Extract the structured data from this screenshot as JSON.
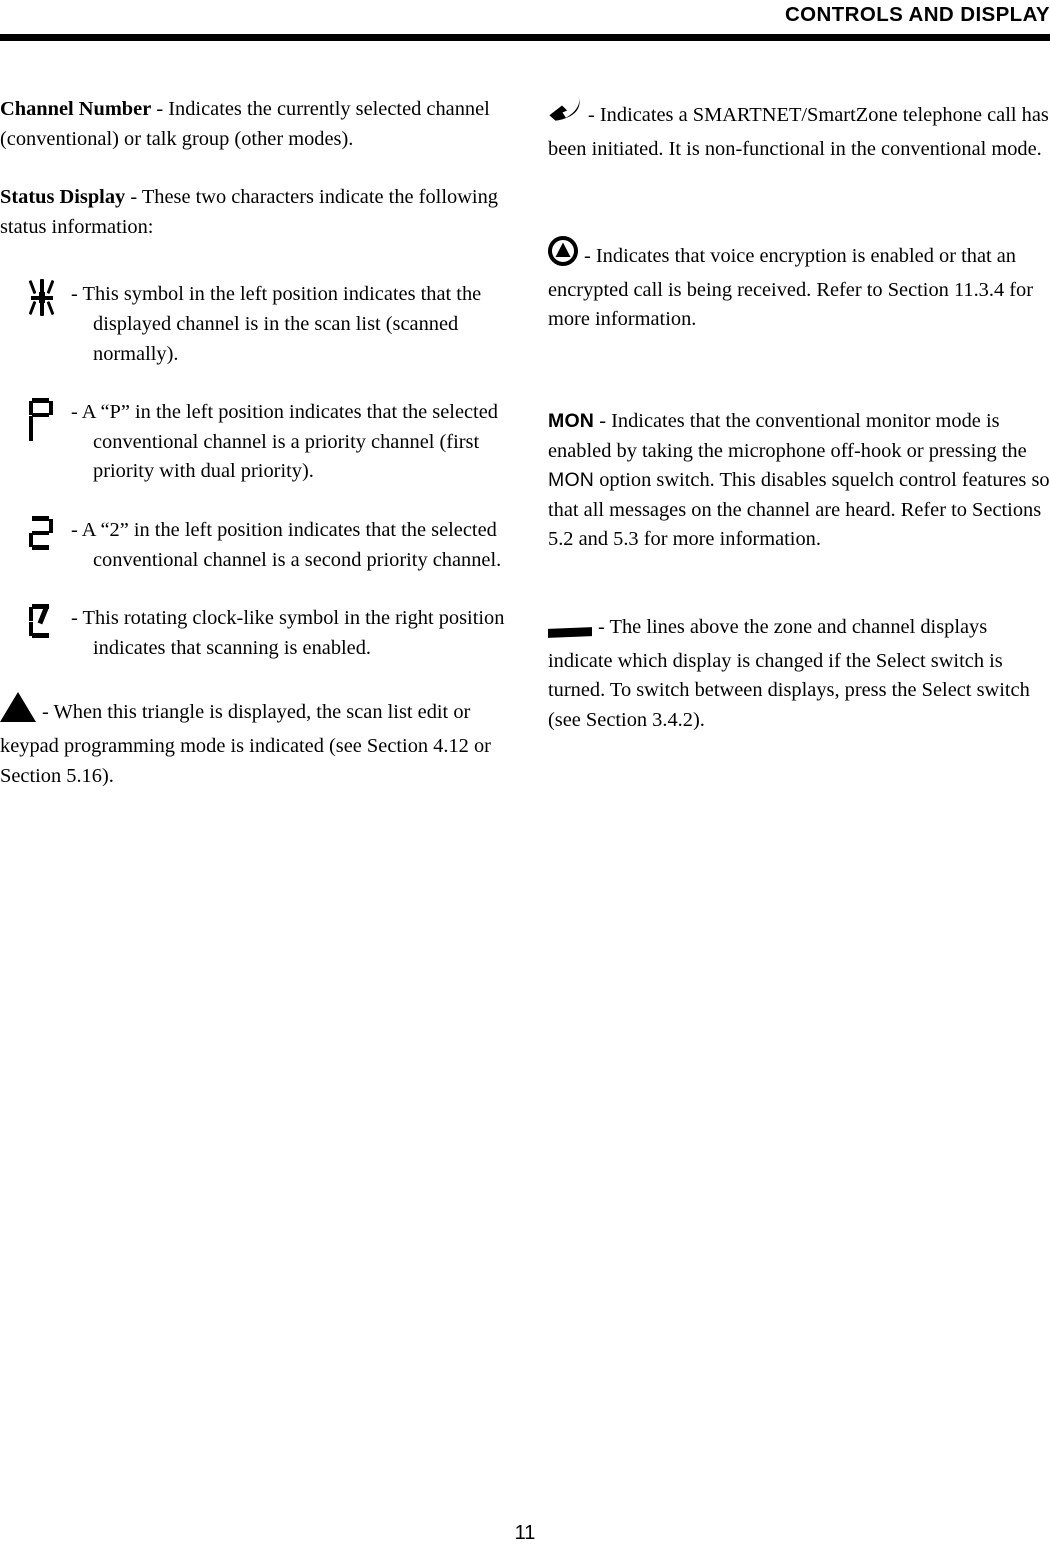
{
  "header": {
    "title": "CONTROLS AND DISPLAY"
  },
  "footer": {
    "page_number": "11"
  },
  "left_column": {
    "channel_number": {
      "lead": "Channel Number",
      "dash": " - ",
      "body": "Indicates the currently selected channel (conventional) or talk group (other modes)."
    },
    "status_display": {
      "lead": "Status Display",
      "dash": " - ",
      "body": "These two characters indicate the following status information:"
    },
    "items": [
      {
        "symbol": "scan-list-starburst-symbol",
        "text": "- This symbol in the left position indicates that the displayed channel is in the scan list (scanned normally)."
      },
      {
        "symbol": "seven-segment-p-symbol",
        "text": "- A “P” in the left position indicates that the selected conventional channel is a priority channel (first priority with dual priority)."
      },
      {
        "symbol": "seven-segment-two-symbol",
        "text": "- A “2” in the left position indicates that the selected conventional channel is a second priority channel."
      },
      {
        "symbol": "rotating-clock-symbol",
        "text": "- This rotating clock-like symbol in the right position indicates that scanning is enabled."
      }
    ],
    "triangle_item": {
      "symbol": "solid-triangle-symbol",
      "text": "- When this triangle is displayed, the scan list edit or keypad programming mode is indicated (see Section 4.12 or Section 5.16)."
    }
  },
  "right_column": {
    "telephone_item": {
      "symbol": "telephone-handset-icon",
      "text": "- Indicates a SMARTNET/SmartZone telephone call has been initiated. It is non-functional in the conventional mode."
    },
    "encryption_item": {
      "symbol": "encryption-circle-triangle-icon",
      "text": "- Indicates that voice encryption is enabled or that an encrypted call is being received. Refer to Section 11.3.4 for more information."
    },
    "mon_item": {
      "lead": "MON",
      "dash": " - ",
      "body_part1": "Indicates that the conventional monitor mode is enabled by taking the microphone off-hook or pressing the ",
      "inline_label": "MON",
      "body_part2": " option switch. This disables squelch control features so that all messages on the channel are heard. Refer to Sections 5.2 and 5.3 for more information."
    },
    "select_lines_item": {
      "symbol": "select-display-bar-icon",
      "text": "- The lines above the zone and channel displays indicate which display is changed if the Select switch is turned. To switch between displays, press the Select switch (see Section 3.4.2)."
    }
  },
  "colors": {
    "ink": "#000000",
    "paper": "#ffffff"
  }
}
